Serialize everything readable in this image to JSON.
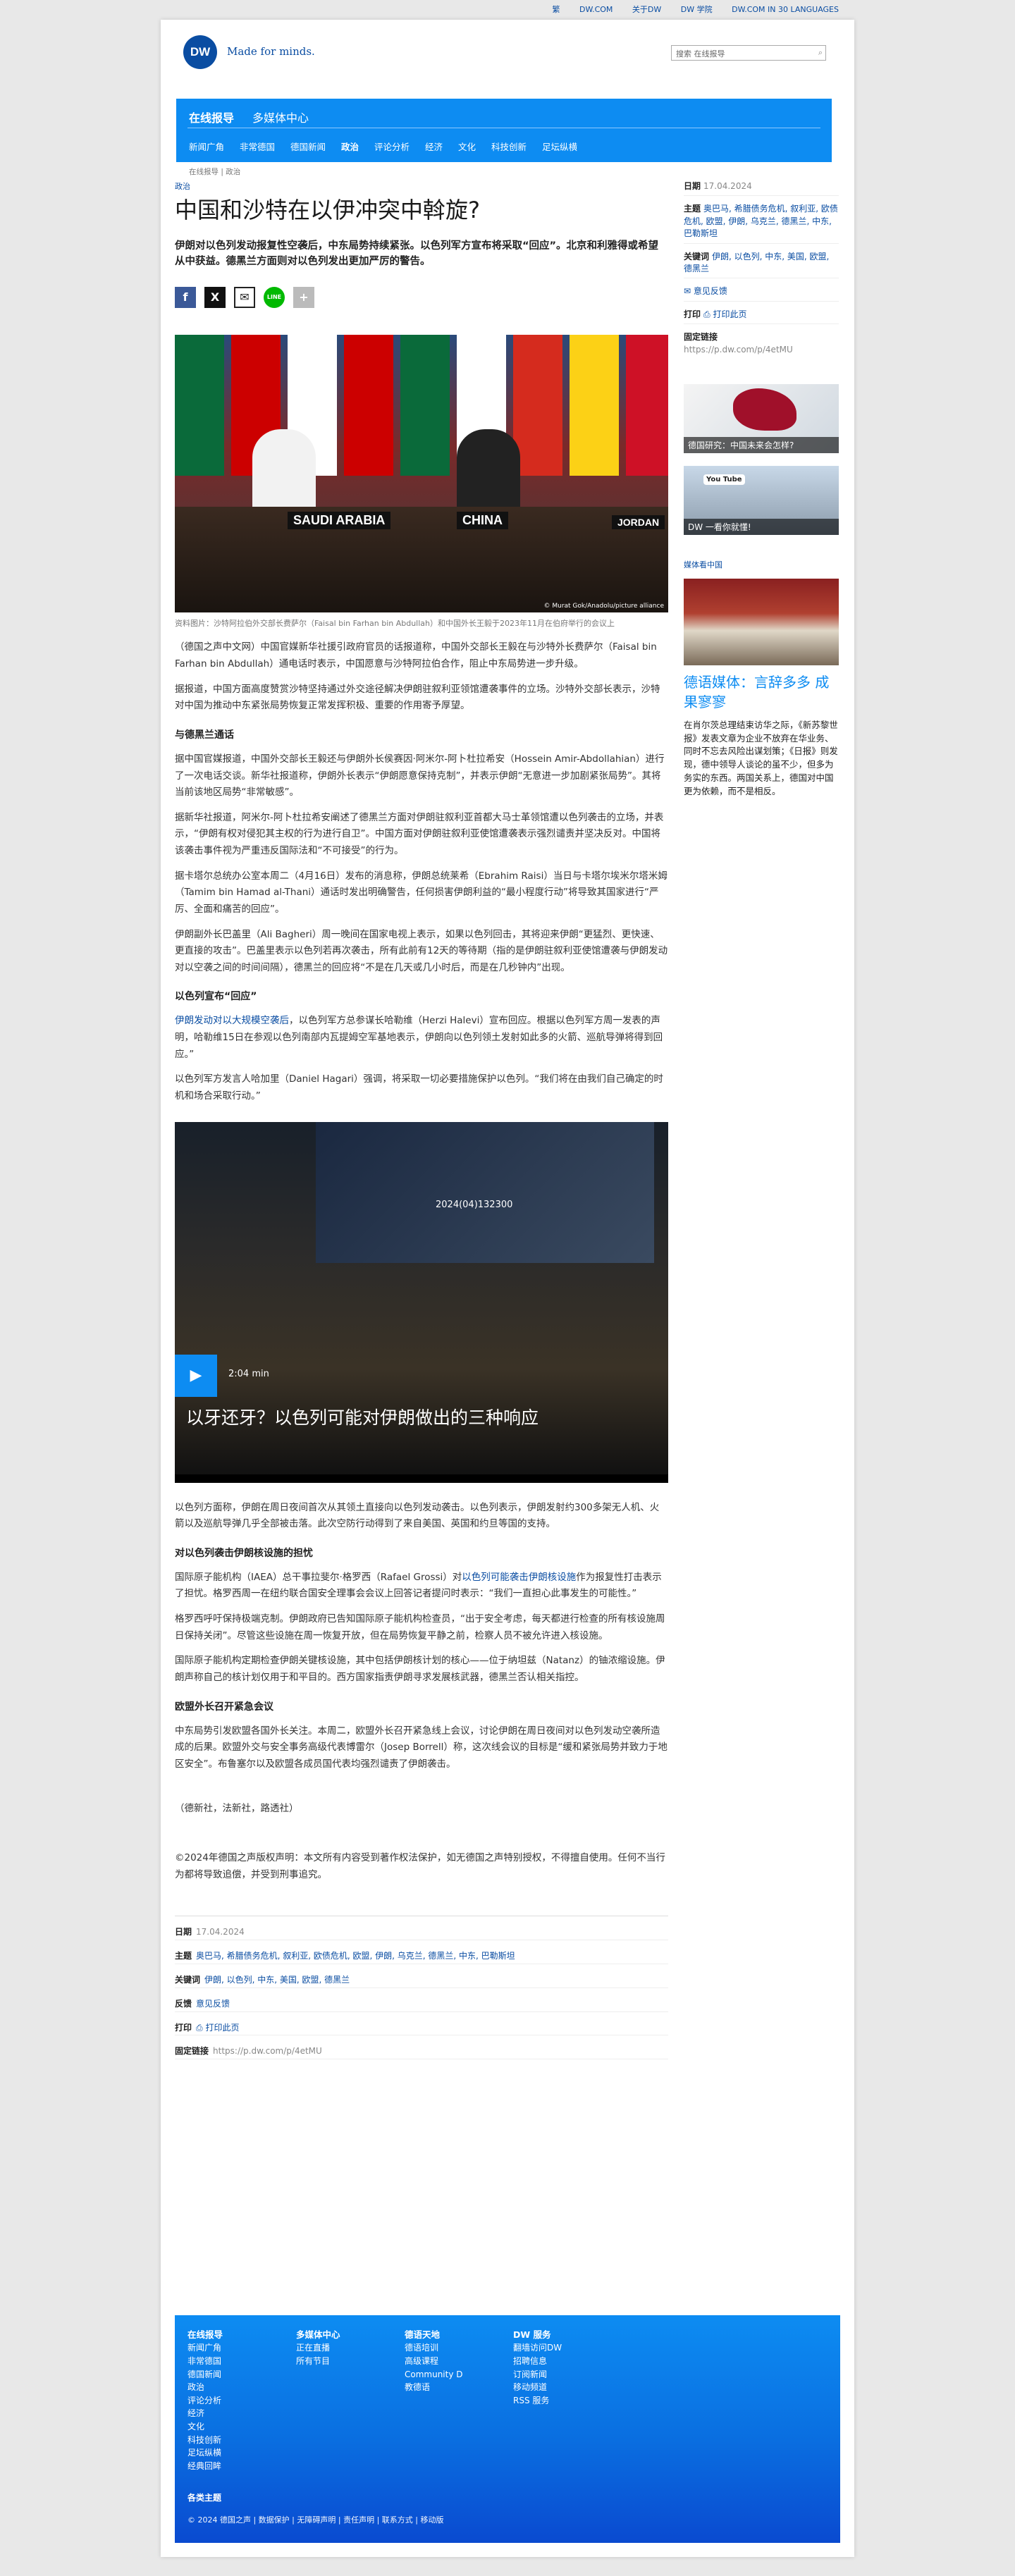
{
  "topbar": {
    "links": [
      "繁",
      "DW.COM",
      "关于DW",
      "DW 学院",
      "DW.COM IN 30 LANGUAGES"
    ]
  },
  "header": {
    "logo": "DW",
    "tagline": "Made for minds.",
    "search_placeholder": "搜索 在线报导"
  },
  "nav": {
    "tab_reports": "在线报导",
    "tab_media": "多媒体中心",
    "items": [
      "新闻广角",
      "非常德国",
      "德国新闻",
      "政治",
      "评论分析",
      "经济",
      "文化",
      "科技创新",
      "足坛纵横"
    ],
    "active": "政治"
  },
  "breadcrumb": "在线报导 | 政治",
  "article": {
    "kicker": "政治",
    "title": "中国和沙特在以伊冲突中斡旋?",
    "lead": "伊朗对以色列发动报复性空袭后，中东局势持续紧张。以色列军方宣布将采取“回应”。北京和利雅得或希望从中获益。德黑兰方面则对以色列发出更加严厉的警告。",
    "share_icons": [
      "f",
      "X",
      "✉",
      "LINE",
      "+"
    ],
    "hero_names": [
      "SAUDI ARABIA",
      "CHINA",
      "JORDAN"
    ],
    "hero_copyright": "© Murat Gok/Anadolu/picture alliance",
    "caption": "资料图片：沙特阿拉伯外交部长费萨尔（Faisal bin Farhan bin Abdullah）和中国外长王毅于2023年11月在伯府举行的会议上",
    "paragraphs_1": [
      "（德国之声中文网）中国官媒新华社援引政府官员的话报道称，中国外交部长王毅在与沙特外长费萨尔（Faisal bin Farhan bin Abdullah）通电话时表示，中国愿意与沙特阿拉伯合作，阻止中东局势进一步升级。",
      "据报道，中国方面高度赞赏沙特坚持通过外交途径解决伊朗驻叙利亚领馆遭袭事件的立场。沙特外交部长表示，沙特对中国为推动中东紧张局势恢复正常发挥积极、重要的作用寄予厚望。"
    ],
    "h_iran": "与德黑兰通话",
    "paragraphs_2": [
      "据中国官媒报道，中国外交部长王毅还与伊朗外长侯赛因·阿米尔-阿卜杜拉希安（Hossein Amir-Abdollahian）进行了一次电话交谈。新华社报道称，伊朗外长表示“伊朗愿意保持克制”，并表示伊朗“无意进一步加剧紧张局势”。其将当前该地区局势“非常敏感”。",
      "据新华社报道，阿米尔-阿卜杜拉希安阐述了德黑兰方面对伊朗驻叙利亚首都大马士革领馆遭以色列袭击的立场，并表示，“伊朗有权对侵犯其主权的行为进行自卫”。中国方面对伊朗驻叙利亚使馆遭袭表示强烈谴责并坚决反对。中国将该袭击事件视为严重违反国际法和“不可接受”的行为。",
      "据卡塔尔总统办公室本周二（4月16日）发布的消息称，伊朗总统莱希（Ebrahim Raisi）当日与卡塔尔埃米尔塔米姆（Tamim bin Hamad al-Thani）通话时发出明确警告，任何损害伊朗利益的“最小程度行动”将导致其国家进行“严厉、全面和痛苦的回应”。",
      "伊朗副外长巴盖里（Ali Bagheri）周一晚间在国家电视上表示，如果以色列回击，其将迎来伊朗“更猛烈、更快速、更直接的攻击”。巴盖里表示以色列若再次袭击，所有此前有12天的等待期（指的是伊朗驻叙利亚使馆遭袭与伊朗发动对以空袭之间的时间间隔），德黑兰的回应将“不是在几天或几小时后，而是在几秒钟内”出现。"
    ],
    "h_israel": "以色列宣布“回应”",
    "israel_link": "伊朗发动对以大规模空袭后",
    "israel_text": "，以色列军方总参谋长哈勒维（Herzi Halevi）宣布回应。根据以色列军方周一发表的声明，哈勒维15日在参观以色列南部内瓦提姆空军基地表示，伊朗向以色列领土发射如此多的火箭、巡航导弹将得到回应。”",
    "paragraph_hagari": "以色列军方发言人哈加里（Daniel Hagari）强调，将采取一切必要措施保护以色列。“我们将在由我们自己确定的时机和场合采取行动。”",
    "video": {
      "duration": "2:04 min",
      "title": "以牙还牙？以色列可能对伊朗做出的三种响应",
      "screen_text": "2024(04)132300"
    },
    "paragraph_after_video": "以色列方面称，伊朗在周日夜间首次从其领土直接向以色列发动袭击。以色列表示，伊朗发射约300多架无人机、火箭以及巡航导弹几乎全部被击落。此次空防行动得到了来自美国、英国和约旦等国的支持。",
    "h_nuclear": "对以色列袭击伊朗核设施的担忧",
    "nuclear_pre": "国际原子能机构（IAEA）总干事拉斐尔·格罗西（Rafael Grossi）对",
    "nuclear_link": "以色列可能袭击伊朗核设施",
    "nuclear_post": "作为报复性打击表示了担忧。格罗西周一在纽约联合国安全理事会会议上回答记者提问时表示：“我们一直担心此事发生的可能性。”",
    "paragraphs_3": [
      "格罗西呼吁保持极端克制。伊朗政府已告知国际原子能机构检查员，“出于安全考虑，每天都进行检查的所有核设施周日保持关闭”。尽管这些设施在周一恢复开放，但在局势恢复平静之前，检察人员不被允许进入核设施。",
      "国际原子能机构定期检查伊朗关键核设施，其中包括伊朗核计划的核心——位于纳坦兹（Natanz）的铀浓缩设施。伊朗声称自己的核计划仅用于和平目的。西方国家指责伊朗寻求发展核武器，德黑兰否认相关指控。"
    ],
    "h_eu": "欧盟外长召开紧急会议",
    "paragraph_eu": "中东局势引发欧盟各国外长关注。本周二，欧盟外长召开紧急线上会议，讨论伊朗在周日夜间对以色列发动空袭所造成的后果。欧盟外交与安全事务高级代表博雷尔（Josep Borrell）称，这次线会议的目标是“缓和紧张局势并致力于地区安全”。布鲁塞尔以及欧盟各成员国代表均强烈谴责了伊朗袭击。",
    "sources": "（德新社，法新社，路透社）",
    "copyright_note": "©2024年德国之声版权声明：本文所有内容受到著作权法保护，如无德国之声特别授权，不得擅自使用。任何不当行为都将导致追偿，并受到刑事追究。"
  },
  "meta": {
    "date_label": "日期",
    "date": "17.04.2024",
    "topics_label": "主题",
    "topics": "奥巴马, 希腊债务危机, 叙利亚, 欧债危机, 欧盟, 伊朗, 乌克兰, 德黑兰, 中东, 巴勒斯坦",
    "keywords_label": "关键词",
    "keywords": "伊朗, 以色列, 中东, 美国, 欧盟, 德黑兰",
    "feedback_label": "反馈",
    "feedback": "意见反馈",
    "print_label": "打印",
    "print": "打印此页",
    "link_label": "固定链接",
    "link": "https://p.dw.com/p/4etMU"
  },
  "sidebar": {
    "date_label": "日期",
    "date": "17.04.2024",
    "topics_label": "主题",
    "topics": "奥巴马, 希腊债务危机, 叙利亚, 欧债危机, 欧盟, 伊朗, 乌克兰, 德黑兰, 中东, 巴勒斯坦",
    "keywords_label": "关键词",
    "keywords": "伊朗, 以色列, 中东, 美国, 欧盟, 德黑兰",
    "feedback": "意见反馈",
    "print_label": "打印",
    "print": "打印此页",
    "link_label": "固定链接",
    "link": "https://p.dw.com/p/4etMU",
    "promo1": "德国研究：中国未来会怎样?",
    "promo2": "DW 一看你就懂!",
    "promo2_logo": "You Tube",
    "media_label": "媒体看中国",
    "teaser_title": "德语媒体：言辞多多 成果寥寥",
    "teaser_text": "在肖尔茨总理结束访华之际，《新苏黎世报》发表文章为企业不放弃在华业务、同时不忘去风险出谋划策；《日报》则发现，德中领导人谈论的虽不少，但多为务实的东西。两国关系上，德国对中国更为依赖，而不是相反。"
  },
  "footer": {
    "col1_title": "在线报导",
    "col1": [
      "新闻广角",
      "非常德国",
      "德国新闻",
      "政治",
      "评论分析",
      "经济",
      "文化",
      "科技创新",
      "足坛纵横",
      "经典回眸"
    ],
    "col2_title": "多媒体中心",
    "col2": [
      "正在直播",
      "所有节目"
    ],
    "col3_title": "德语天地",
    "col3": [
      "德语培训",
      "高级课程",
      "Community D",
      "教德语"
    ],
    "col4_title": "DW 服务",
    "col4": [
      "翻墙访问DW",
      "招聘信息",
      "订阅新闻",
      "移动频道",
      "RSS 服务"
    ],
    "themes": "各类主题",
    "legal": "© 2024 德国之声 | 数据保护 | 无障碍声明 | 责任声明 | 联系方式 | 移动版"
  }
}
